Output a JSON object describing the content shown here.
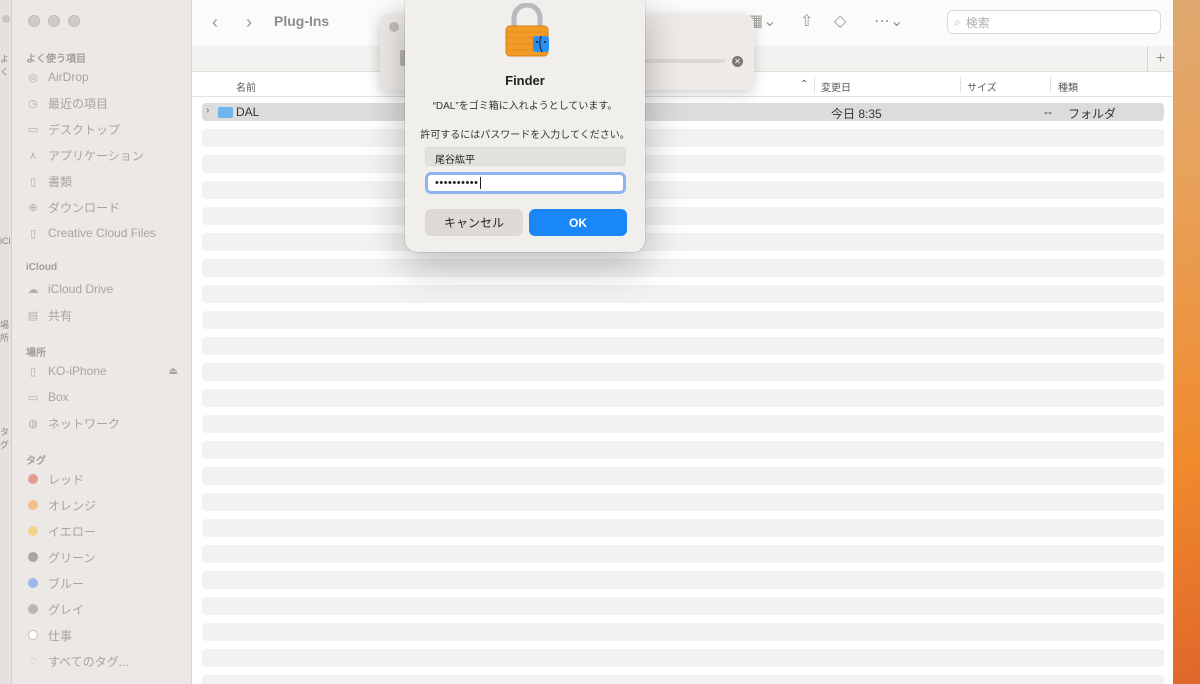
{
  "window": {
    "title": "Plug-Ins"
  },
  "sidebar": {
    "favorites_header": "よく使う項目",
    "favorites": [
      {
        "label": "AirDrop",
        "icon": "airdrop-icon"
      },
      {
        "label": "最近の項目",
        "icon": "clock-icon"
      },
      {
        "label": "デスクトップ",
        "icon": "desktop-icon"
      },
      {
        "label": "アプリケーション",
        "icon": "apps-icon"
      },
      {
        "label": "書類",
        "icon": "document-icon"
      },
      {
        "label": "ダウンロード",
        "icon": "download-icon"
      },
      {
        "label": "Creative Cloud Files",
        "icon": "file-icon"
      }
    ],
    "icloud_header": "iCloud",
    "icloud": [
      {
        "label": "iCloud Drive",
        "icon": "cloud-icon"
      },
      {
        "label": "共有",
        "icon": "shared-folder-icon"
      }
    ],
    "locations_header": "場所",
    "locations": [
      {
        "label": "KO-iPhone",
        "icon": "iphone-icon"
      },
      {
        "label": "Box",
        "icon": "box-icon"
      },
      {
        "label": "ネットワーク",
        "icon": "network-icon"
      }
    ],
    "tags_header": "タグ",
    "tags": [
      {
        "label": "レッド",
        "color": "#e79b95"
      },
      {
        "label": "オレンジ",
        "color": "#f2c08a"
      },
      {
        "label": "イエロー",
        "color": "#f3d58a"
      },
      {
        "label": "グリーン",
        "color": "#a8a6a4"
      },
      {
        "label": "ブルー",
        "color": "#9ab8ea"
      },
      {
        "label": "グレイ",
        "color": "#b9b6b3"
      },
      {
        "label": "仕事",
        "color": "#ffffff"
      },
      {
        "label": "すべてのタグ...",
        "color": "#d9d6d3"
      }
    ]
  },
  "toolbar": {
    "search_placeholder": "検索"
  },
  "columns": {
    "name": "名前",
    "modified": "変更日",
    "size": "サイズ",
    "kind": "種類"
  },
  "files": [
    {
      "name": "DAL",
      "modified": "今日 8:35",
      "size": "--",
      "kind": "フォルダ"
    }
  ],
  "auth_dialog": {
    "app": "Finder",
    "message": "“DAL”をゴミ箱に入れようとしています。",
    "prompt": "許可するにはパスワードを入力してください。",
    "username": "尾谷紘平",
    "password_mask": "••••••••••",
    "cancel_label": "キャンセル",
    "ok_label": "OK"
  },
  "back_window": {
    "fragments": [
      "よく",
      "iCl",
      "場所",
      "タグ"
    ]
  }
}
